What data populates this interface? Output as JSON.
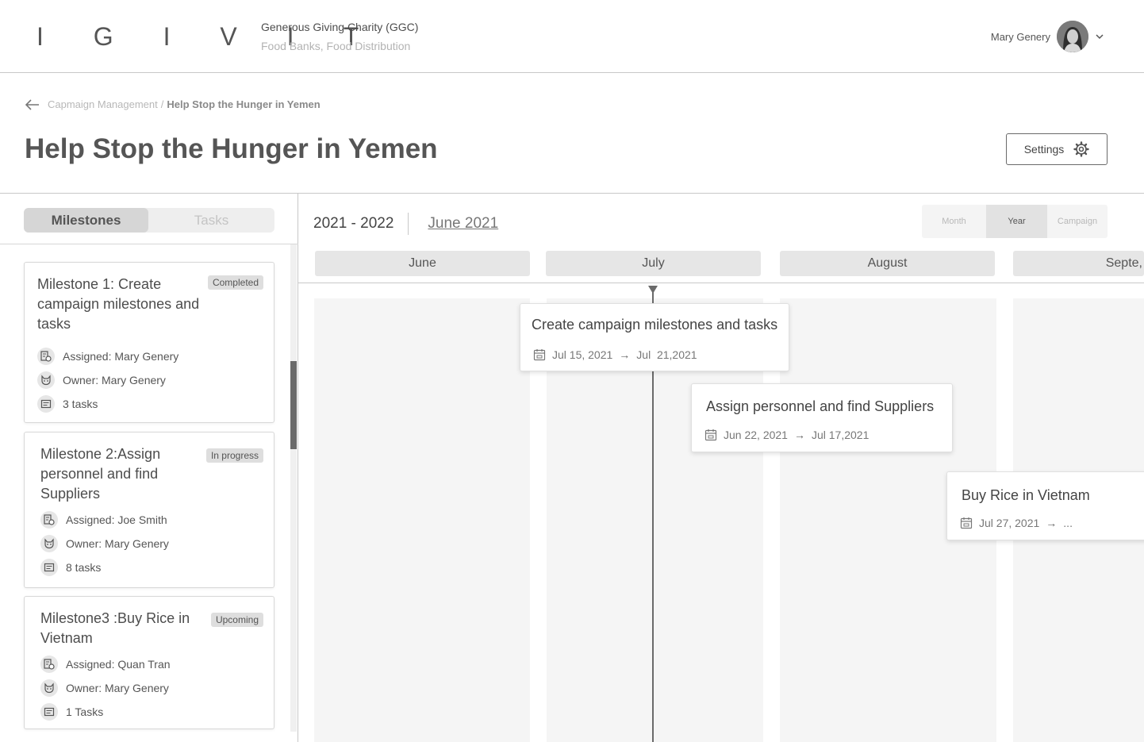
{
  "header": {
    "logo": "I G I V I T",
    "org_name": "Generous Giving Charity (GGC)",
    "org_category": "Food Banks, Food Distribution",
    "user_name": "Mary Genery"
  },
  "breadcrumb": {
    "parent": "Capmaign Management",
    "separator": "/",
    "current": "Help Stop the Hunger in Yemen"
  },
  "page": {
    "title": "Help Stop the Hunger in Yemen",
    "settings_label": "Settings"
  },
  "left_panel": {
    "tabs": [
      "Milestones",
      "Tasks"
    ],
    "milestones": [
      {
        "title": "Milestone 1: Create campaign milestones and tasks",
        "status": "Completed",
        "assigned": "Assigned: Mary Genery",
        "owner": "Owner: Mary Genery",
        "tasks": "3 tasks"
      },
      {
        "title": "Milestone 2:Assign personnel and find Suppliers",
        "status": "In progress",
        "assigned": "Assigned: Joe Smith",
        "owner": "Owner: Mary Genery",
        "tasks": "8 tasks"
      },
      {
        "title": "Milestone3 :Buy Rice in Vietnam",
        "status": "Upcoming",
        "assigned": "Assigned: Quan Tran",
        "owner": "Owner: Mary Genery",
        "tasks": "1 Tasks"
      }
    ]
  },
  "timeline": {
    "year_range": "2021 - 2022",
    "current_month": "June 2021",
    "views": [
      "Month",
      "Year",
      "Campaign"
    ],
    "active_view": "Year",
    "months": [
      "June",
      "July",
      "August",
      "Septe,"
    ],
    "events": [
      {
        "title": "Create campaign milestones and tasks",
        "start": "Jul 15, 2021",
        "end": "Jul  21,2021"
      },
      {
        "title": "Assign personnel and find Suppliers",
        "start": "Jun 22, 2021",
        "end": "Jul 17,2021"
      },
      {
        "title": "Buy Rice in Vietnam",
        "start": "Jul 27, 2021",
        "end": "..."
      }
    ]
  },
  "icons": {
    "back": "arrow-left-icon",
    "settings": "gear-icon",
    "chevron": "chevron-down-icon",
    "assigned": "assigned-icon",
    "owner": "owner-icon",
    "tasks": "tasks-icon",
    "calendar": "calendar-icon"
  }
}
